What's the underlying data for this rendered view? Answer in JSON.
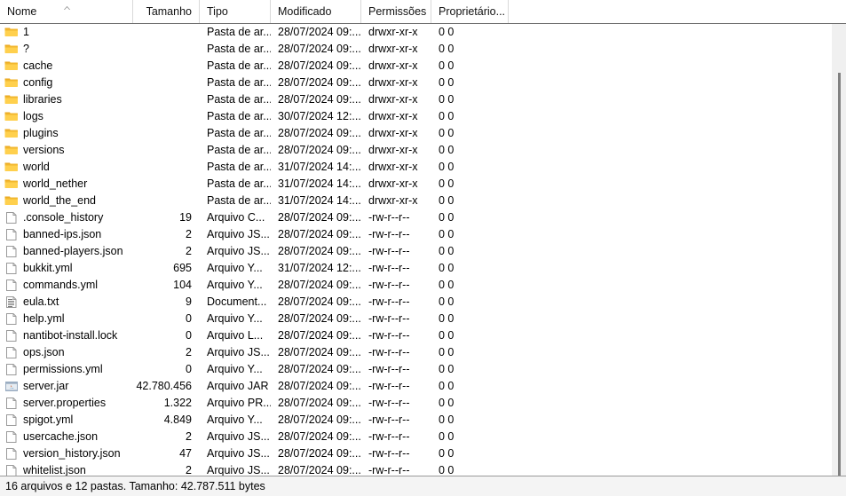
{
  "columns": [
    {
      "key": "name",
      "label": "Nome",
      "align": "left"
    },
    {
      "key": "size",
      "label": "Tamanho",
      "align": "right"
    },
    {
      "key": "type",
      "label": "Tipo",
      "align": "left"
    },
    {
      "key": "mod",
      "label": "Modificado",
      "align": "left"
    },
    {
      "key": "perm",
      "label": "Permissões",
      "align": "left"
    },
    {
      "key": "owner",
      "label": "Proprietário...",
      "align": "left"
    }
  ],
  "sort": {
    "column": "Nome",
    "direction": "ascending",
    "indicator": "chevron-up-icon"
  },
  "rows": [
    {
      "icon": "folder-icon",
      "name": "1",
      "size": "",
      "type": "Pasta de ar...",
      "mod": "28/07/2024 09:...",
      "perm": "drwxr-xr-x",
      "owner": "0 0"
    },
    {
      "icon": "folder-icon",
      "name": "?",
      "size": "",
      "type": "Pasta de ar...",
      "mod": "28/07/2024 09:...",
      "perm": "drwxr-xr-x",
      "owner": "0 0"
    },
    {
      "icon": "folder-icon",
      "name": "cache",
      "size": "",
      "type": "Pasta de ar...",
      "mod": "28/07/2024 09:...",
      "perm": "drwxr-xr-x",
      "owner": "0 0"
    },
    {
      "icon": "folder-icon",
      "name": "config",
      "size": "",
      "type": "Pasta de ar...",
      "mod": "28/07/2024 09:...",
      "perm": "drwxr-xr-x",
      "owner": "0 0"
    },
    {
      "icon": "folder-icon",
      "name": "libraries",
      "size": "",
      "type": "Pasta de ar...",
      "mod": "28/07/2024 09:...",
      "perm": "drwxr-xr-x",
      "owner": "0 0"
    },
    {
      "icon": "folder-icon",
      "name": "logs",
      "size": "",
      "type": "Pasta de ar...",
      "mod": "30/07/2024 12:...",
      "perm": "drwxr-xr-x",
      "owner": "0 0"
    },
    {
      "icon": "folder-icon",
      "name": "plugins",
      "size": "",
      "type": "Pasta de ar...",
      "mod": "28/07/2024 09:...",
      "perm": "drwxr-xr-x",
      "owner": "0 0"
    },
    {
      "icon": "folder-icon",
      "name": "versions",
      "size": "",
      "type": "Pasta de ar...",
      "mod": "28/07/2024 09:...",
      "perm": "drwxr-xr-x",
      "owner": "0 0"
    },
    {
      "icon": "folder-icon",
      "name": "world",
      "size": "",
      "type": "Pasta de ar...",
      "mod": "31/07/2024 14:...",
      "perm": "drwxr-xr-x",
      "owner": "0 0"
    },
    {
      "icon": "folder-icon",
      "name": "world_nether",
      "size": "",
      "type": "Pasta de ar...",
      "mod": "31/07/2024 14:...",
      "perm": "drwxr-xr-x",
      "owner": "0 0"
    },
    {
      "icon": "folder-icon",
      "name": "world_the_end",
      "size": "",
      "type": "Pasta de ar...",
      "mod": "31/07/2024 14:...",
      "perm": "drwxr-xr-x",
      "owner": "0 0"
    },
    {
      "icon": "file-icon",
      "name": ".console_history",
      "size": "19",
      "type": "Arquivo C...",
      "mod": "28/07/2024 09:...",
      "perm": "-rw-r--r--",
      "owner": "0 0"
    },
    {
      "icon": "file-icon",
      "name": "banned-ips.json",
      "size": "2",
      "type": "Arquivo JS...",
      "mod": "28/07/2024 09:...",
      "perm": "-rw-r--r--",
      "owner": "0 0"
    },
    {
      "icon": "file-icon",
      "name": "banned-players.json",
      "size": "2",
      "type": "Arquivo JS...",
      "mod": "28/07/2024 09:...",
      "perm": "-rw-r--r--",
      "owner": "0 0"
    },
    {
      "icon": "file-icon",
      "name": "bukkit.yml",
      "size": "695",
      "type": "Arquivo Y...",
      "mod": "31/07/2024 12:...",
      "perm": "-rw-r--r--",
      "owner": "0 0"
    },
    {
      "icon": "file-icon",
      "name": "commands.yml",
      "size": "104",
      "type": "Arquivo Y...",
      "mod": "28/07/2024 09:...",
      "perm": "-rw-r--r--",
      "owner": "0 0"
    },
    {
      "icon": "text-file-icon",
      "name": "eula.txt",
      "size": "9",
      "type": "Document...",
      "mod": "28/07/2024 09:...",
      "perm": "-rw-r--r--",
      "owner": "0 0"
    },
    {
      "icon": "file-icon",
      "name": "help.yml",
      "size": "0",
      "type": "Arquivo Y...",
      "mod": "28/07/2024 09:...",
      "perm": "-rw-r--r--",
      "owner": "0 0"
    },
    {
      "icon": "file-icon",
      "name": "nantibot-install.lock",
      "size": "0",
      "type": "Arquivo L...",
      "mod": "28/07/2024 09:...",
      "perm": "-rw-r--r--",
      "owner": "0 0"
    },
    {
      "icon": "file-icon",
      "name": "ops.json",
      "size": "2",
      "type": "Arquivo JS...",
      "mod": "28/07/2024 09:...",
      "perm": "-rw-r--r--",
      "owner": "0 0"
    },
    {
      "icon": "file-icon",
      "name": "permissions.yml",
      "size": "0",
      "type": "Arquivo Y...",
      "mod": "28/07/2024 09:...",
      "perm": "-rw-r--r--",
      "owner": "0 0"
    },
    {
      "icon": "jar-file-icon",
      "name": "server.jar",
      "size": "42.780.456",
      "type": "Arquivo JAR",
      "mod": "28/07/2024 09:...",
      "perm": "-rw-r--r--",
      "owner": "0 0"
    },
    {
      "icon": "file-icon",
      "name": "server.properties",
      "size": "1.322",
      "type": "Arquivo PR...",
      "mod": "28/07/2024 09:...",
      "perm": "-rw-r--r--",
      "owner": "0 0"
    },
    {
      "icon": "file-icon",
      "name": "spigot.yml",
      "size": "4.849",
      "type": "Arquivo Y...",
      "mod": "28/07/2024 09:...",
      "perm": "-rw-r--r--",
      "owner": "0 0"
    },
    {
      "icon": "file-icon",
      "name": "usercache.json",
      "size": "2",
      "type": "Arquivo JS...",
      "mod": "28/07/2024 09:...",
      "perm": "-rw-r--r--",
      "owner": "0 0"
    },
    {
      "icon": "file-icon",
      "name": "version_history.json",
      "size": "47",
      "type": "Arquivo JS...",
      "mod": "28/07/2024 09:...",
      "perm": "-rw-r--r--",
      "owner": "0 0"
    },
    {
      "icon": "file-icon",
      "name": "whitelist.json",
      "size": "2",
      "type": "Arquivo JS...",
      "mod": "28/07/2024 09:...",
      "perm": "-rw-r--r--",
      "owner": "0 0"
    }
  ],
  "statusbar": {
    "text": "16 arquivos e 12 pastas. Tamanho: 42.787.511 bytes"
  },
  "scrollbar": {
    "orientation": "vertical"
  },
  "colors": {
    "folder_tab": "#e8a317",
    "folder_body": "#ffd04d",
    "file_page": "#ffffff",
    "file_outline": "#9a9a9a",
    "jar_tint": "#9badc2",
    "header_rule": "#6f6f6f",
    "column_divider": "#d9d9d9",
    "scroll_track": "#f0f0f0",
    "scroll_thumb": "#808080",
    "statusbar_bg": "#f4f4f4"
  }
}
